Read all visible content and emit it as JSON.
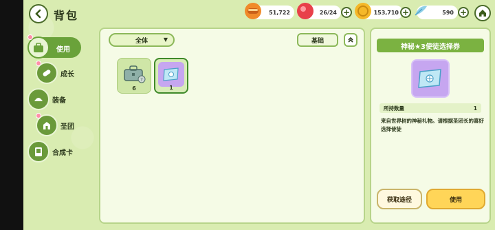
{
  "header": {
    "back_icon": "chevron-left-icon",
    "title": "背包",
    "resources": [
      {
        "name": "bread",
        "icon": "bread-icon",
        "value": "51,722",
        "color": "#f08a2a"
      },
      {
        "name": "gem",
        "icon": "red-orb-icon",
        "value": "26/24",
        "color": "#e8404a"
      },
      {
        "name": "coin",
        "icon": "coin-icon",
        "value": "153,710",
        "color": "#f5b829"
      },
      {
        "name": "feather",
        "icon": "feather-icon",
        "value": "590",
        "color": "#8fd0e8"
      }
    ],
    "home_icon": "home-icon"
  },
  "sidebar": {
    "items": [
      {
        "label": "使用",
        "icon": "toolbox-icon",
        "active": true
      },
      {
        "label": "成长",
        "icon": "pill-icon"
      },
      {
        "label": "装备",
        "icon": "bun-icon"
      },
      {
        "label": "圣团",
        "icon": "castle-icon"
      },
      {
        "label": "合成卡",
        "icon": "card-icon"
      }
    ]
  },
  "main": {
    "filter": {
      "selected": "全体"
    },
    "sort_label": "基础",
    "collapse_icon": "double-chevron-up-icon",
    "items": [
      {
        "icon": "toolbox-icon",
        "count": "6"
      },
      {
        "icon": "ticket-icon",
        "count": "1",
        "selected": true
      }
    ]
  },
  "detail": {
    "title": "神秘★3使徒选择券",
    "held_label": "所持数量",
    "held_value": "1",
    "description": "来自世界树的神秘礼物。请根据圣团长的喜好选择使徒",
    "source_button": "获取途径",
    "use_button": "使用"
  },
  "colors": {
    "accent_green": "#7bb241",
    "use_yellow": "#ffd558",
    "panel_bg": "#f5fbe6"
  }
}
